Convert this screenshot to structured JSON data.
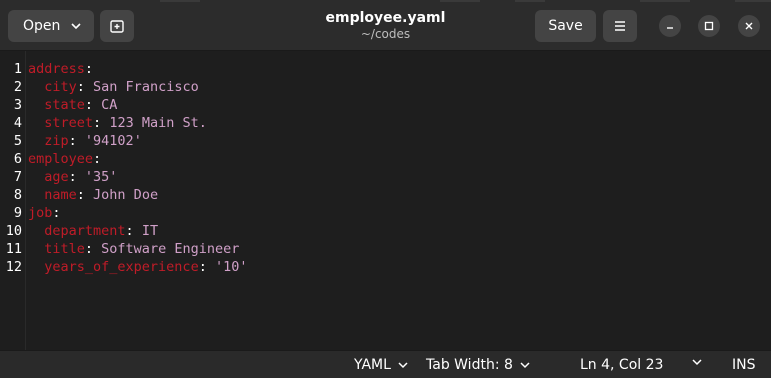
{
  "header": {
    "open_label": "Open",
    "title": "employee.yaml",
    "subtitle": "~/codes",
    "save_label": "Save",
    "icons": {
      "open_dropdown": "chevron-down-icon",
      "new_tab": "new-tab-icon",
      "menu": "hamburger-menu-icon",
      "minimize": "minimize-icon",
      "maximize": "maximize-icon",
      "close": "close-icon"
    }
  },
  "editor": {
    "lines": [
      {
        "n": "1",
        "indent": "",
        "key": "address",
        "sep": ":",
        "value": ""
      },
      {
        "n": "2",
        "indent": "  ",
        "key": "city",
        "sep": ": ",
        "value": "San Francisco"
      },
      {
        "n": "3",
        "indent": "  ",
        "key": "state",
        "sep": ": ",
        "value": "CA"
      },
      {
        "n": "4",
        "indent": "  ",
        "key": "street",
        "sep": ": ",
        "value": "123 Main St."
      },
      {
        "n": "5",
        "indent": "  ",
        "key": "zip",
        "sep": ": ",
        "value": "'94102'"
      },
      {
        "n": "6",
        "indent": "",
        "key": "employee",
        "sep": ":",
        "value": ""
      },
      {
        "n": "7",
        "indent": "  ",
        "key": "age",
        "sep": ": ",
        "value": "'35'"
      },
      {
        "n": "8",
        "indent": "  ",
        "key": "name",
        "sep": ": ",
        "value": "John Doe"
      },
      {
        "n": "9",
        "indent": "",
        "key": "job",
        "sep": ":",
        "value": ""
      },
      {
        "n": "10",
        "indent": "  ",
        "key": "department",
        "sep": ": ",
        "value": "IT"
      },
      {
        "n": "11",
        "indent": "  ",
        "key": "title",
        "sep": ": ",
        "value": "Software Engineer"
      },
      {
        "n": "12",
        "indent": "  ",
        "key": "years_of_experience",
        "sep": ": ",
        "value": "'10'"
      }
    ]
  },
  "statusbar": {
    "language": "YAML",
    "tab_width": "Tab Width: 8",
    "position": "Ln 4, Col 23",
    "mode": "INS"
  },
  "colors": {
    "key": "#c01c28",
    "value": "#d0a0c8",
    "background": "#1e1e1e",
    "headerbar": "#2c2c2c"
  }
}
